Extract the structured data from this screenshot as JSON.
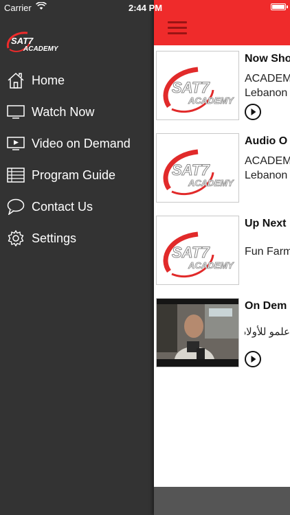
{
  "status_bar": {
    "carrier": "Carrier",
    "time": "2:44 PM"
  },
  "brand": {
    "logo_main": "SAT7",
    "logo_sub": "ACADEMY"
  },
  "menu": [
    {
      "label": "Home",
      "icon": "home-icon"
    },
    {
      "label": "Watch Now",
      "icon": "tv-icon"
    },
    {
      "label": "Video on Demand",
      "icon": "video-play-icon"
    },
    {
      "label": "Program Guide",
      "icon": "guide-list-icon"
    },
    {
      "label": "Contact Us",
      "icon": "chat-bubble-icon"
    },
    {
      "label": "Settings",
      "icon": "gear-icon"
    }
  ],
  "cards": [
    {
      "title": "Now Sho",
      "line1": "ACADEM",
      "line2": "Lebanon",
      "thumb": "sat7-academy-logo"
    },
    {
      "title": "Audio O",
      "line1": "ACADEM",
      "line2": "Lebanon",
      "thumb": "sat7-academy-logo"
    },
    {
      "title": "Up Next",
      "line1": "Fun Farm",
      "thumb": "sat7-academy-logo"
    },
    {
      "title": "On Dem",
      "arabic": "علمو للأولاد؟",
      "thumb": "video-still-man"
    }
  ],
  "colors": {
    "accent": "#ef2b2b",
    "sidebar": "#333333",
    "bottom_bar": "#555555"
  }
}
